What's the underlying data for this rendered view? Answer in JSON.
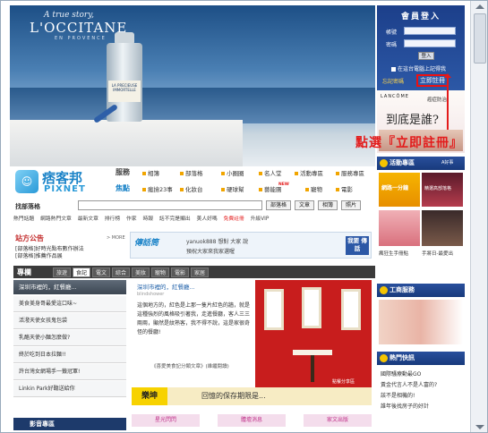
{
  "hero": {
    "tagline": "A true story,",
    "brand": "L'OCCITANE",
    "brand_sub": "EN PROVENCE",
    "bottle_label": "LA PRECIEUSE IMMORTELLE"
  },
  "login": {
    "title": "會員登入",
    "account_label": "帳號",
    "password_label": "密碼",
    "submit": "登入",
    "remember": "在這台電腦上記得我",
    "forgot": "忘記密碼",
    "register": "立即註冊"
  },
  "ad": {
    "brand": "LANCÔME",
    "small": "癌症防治",
    "title": "到底是誰?"
  },
  "annotation": "點選『立即註冊』",
  "logo": {
    "zh": "痞客邦",
    "en": "PIXNET"
  },
  "nav": {
    "services_label": "服務",
    "featured_label": "焦點",
    "services": [
      "相簿",
      "部落格",
      "小圈圈",
      "名人堂",
      "活動專區",
      "服務專區"
    ],
    "featured": [
      "瘋撿23事",
      "化妝台",
      "硬球幫",
      "藝能團",
      "寵物",
      "電影"
    ],
    "new_badge": "NEW"
  },
  "search": {
    "label": "找部落格",
    "buttons": [
      "部落格",
      "文章",
      "相簿",
      "照片"
    ]
  },
  "links": [
    "熱門話題",
    "網路熱門文章",
    "最新文章",
    "排行榜",
    "作家",
    "時報",
    "話不完是顯出",
    "美人好嗎",
    "免費註冊",
    "升級VIP"
  ],
  "bulletin": {
    "title": "站方公告",
    "more": "> MORE",
    "items": [
      "[部落格]好時光點布數作辦法",
      "[部落格]推薦作品展"
    ]
  },
  "mp": {
    "logo": "傳話筒",
    "line1": "yanuok888 想對 大家 說",
    "line2": "預祝大家來我家選喔",
    "btn": "我要 傳話"
  },
  "columns": {
    "title": "專欄",
    "tabs": [
      "旅遊",
      "食記",
      "電文",
      "綜合",
      "美妝",
      "寵物",
      "電影",
      "家居"
    ]
  },
  "leftlist": {
    "head": "深圳市裡的，紅餐廳...",
    "items": [
      "美食美身哥最愛這口味~",
      "活潑天使女孩鬼包袋",
      "乳酪天使小麵怎麼做?",
      "終於吃到日本拉麵!!",
      "許台灣女網場手一籤冠軍!",
      "Linkin Park好聽送給你"
    ]
  },
  "av_bar": "影音專區",
  "article": {
    "title": "深圳市裡的，紅餐廳...",
    "author": "blindshower",
    "body": "這個地方的，紅色是上那一隻片紅色的牆，就是這種強烈的風格吸引著我，走進餐廳，客人三三兩兩，顯然是紋熟客，我不得不說，這是家很奇怪的餐廳!",
    "foot": "《喜愛美食記分類文章》(維繼閱讀)"
  },
  "photo_caption": "點餐分享區",
  "banner": {
    "logo": "樂坤",
    "text": "回憶的保存期限是..."
  },
  "subtabs": [
    "星光閃閃",
    "體壇消息",
    "家文出版"
  ],
  "rside": {
    "events_title": "活動專區",
    "events_more": "A好事",
    "event1_caption": "網路一分鐘",
    "event2_caption": "精選高部落格",
    "event_cap1": "瘋狂生手冊點",
    "event_cap2": "手將日-最愛出",
    "biz_title": "工商服務",
    "news_title": "熱門快訊",
    "news": [
      "國際騷療動最GO",
      "黃金代言人不是人富的?",
      "該不是相機的!",
      "誰年後找房子的好計"
    ]
  },
  "colors": {
    "nav_blue": "#1d3a6b",
    "accent": "#e31b1b",
    "column_bar": "#3b3b3b"
  }
}
